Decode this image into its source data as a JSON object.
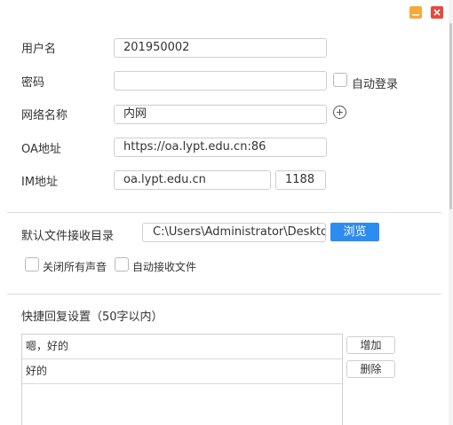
{
  "window": {
    "minimize_icon": "minimize-icon",
    "close_icon": "close-icon",
    "minimize_color": "#f4a93c",
    "close_color": "#e8483d"
  },
  "account": {
    "username_label": "用户名",
    "username_value": "201950002",
    "password_label": "密码",
    "password_value": "",
    "auto_login_label": "自动登录",
    "auto_login_checked": false,
    "network_label": "网络名称",
    "network_value": "内网",
    "add_network_icon": "plus-circle-icon",
    "oa_label": "OA地址",
    "oa_value": "https://oa.lypt.edu.cn:86",
    "im_label": "IM地址",
    "im_host_value": "oa.lypt.edu.cn",
    "im_port_value": "1188"
  },
  "files": {
    "dir_label": "默认文件接收目录",
    "dir_value": "C:\\Users\\Administrator\\Desktop",
    "browse_label": "浏览",
    "browse_color": "#2d8cf0",
    "mute_label": "关闭所有声音",
    "mute_checked": false,
    "auto_receive_label": "自动接收文件",
    "auto_receive_checked": false
  },
  "quick_reply": {
    "title": "快捷回复设置（50字以内）",
    "items": [
      "嗯，好的",
      "好的"
    ],
    "add_label": "增加",
    "delete_label": "删除"
  }
}
